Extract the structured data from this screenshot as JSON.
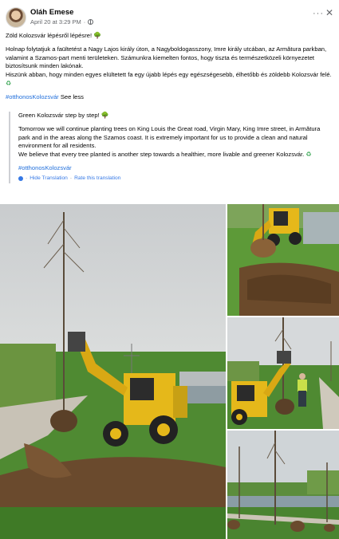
{
  "post": {
    "author": "Oláh Emese",
    "date": "April 20 at 3:29 PM",
    "dot": "·",
    "more_label": "···",
    "close_label": "✕"
  },
  "original": {
    "title": "Zöld Kolozsvár lépésről lépésre!",
    "body": "Holnap folytatjuk a faültetést a Nagy Lajos király úton, a Nagyboldogasszony, Imre király utcában, az Armătura parkban, valamint a Szamos-part menti területeken. Számunkra kiemelten fontos, hogy tiszta és természetközeli környezetet biztosítsunk minden lakónak.\nHiszünk abban, hogy minden egyes elültetett fa egy újabb lépés egy egészségesebb, élhetőbb és zöldebb Kolozsvár felé.",
    "hashtag": "#otthonosKolozsvár",
    "see_less": "See less"
  },
  "translation": {
    "title": "Green Kolozsvár step by step!",
    "body": "Tomorrow we will continue planting trees on King Louis the Great road, Virgin Mary, King Imre street, in Armătura park and in the areas along the Szamos coast. It is extremely important for us to provide a clean and natural environment for all residents.\nWe believe that every tree planted is another step towards a healthier, more livable and greener Kolozsvár.",
    "hashtag": "#otthonosKolozsvár",
    "hide_label": "Hide Translation",
    "separator": "·",
    "rate_label": "Rate this translation"
  },
  "icons": {
    "tree": "🌳",
    "recycle": "♻"
  },
  "colors": {
    "hashtag": "#216fdb",
    "link": "#3578e5",
    "meta": "#65676b"
  }
}
